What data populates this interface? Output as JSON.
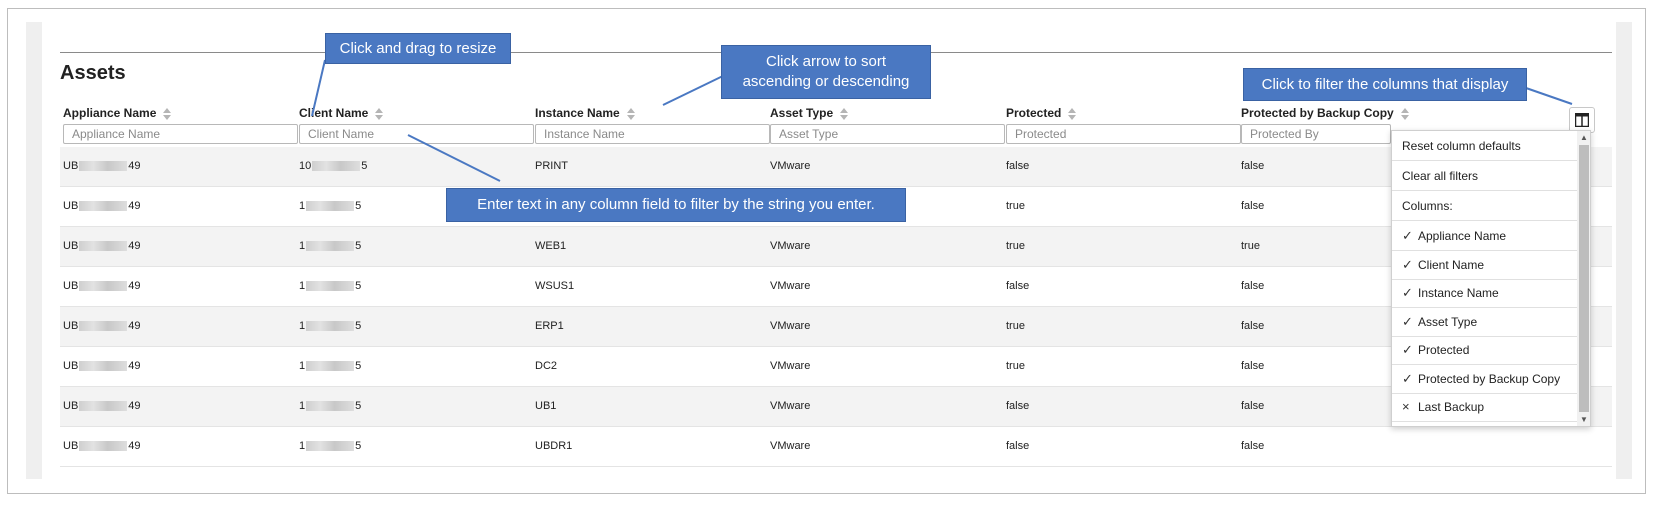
{
  "page": {
    "title": "Assets"
  },
  "columns": [
    {
      "label": "Appliance Name",
      "placeholder": "Appliance Name"
    },
    {
      "label": "Client Name",
      "placeholder": "Client Name"
    },
    {
      "label": "Instance Name",
      "placeholder": "Instance Name"
    },
    {
      "label": "Asset Type",
      "placeholder": "Asset Type"
    },
    {
      "label": "Protected",
      "placeholder": "Protected"
    },
    {
      "label": "Protected by Backup Copy",
      "placeholder": "Protected By"
    }
  ],
  "rows": [
    {
      "appliance_pre": "UB",
      "appliance_post": "49",
      "client_pre": "10",
      "client_post": "5",
      "instance": "PRINT",
      "type": "VMware",
      "protected": "false",
      "backup": "false"
    },
    {
      "appliance_pre": "UB",
      "appliance_post": "49",
      "client_pre": "1",
      "client_post": "5",
      "instance": "",
      "type": "",
      "protected": "true",
      "backup": "false"
    },
    {
      "appliance_pre": "UB",
      "appliance_post": "49",
      "client_pre": "1",
      "client_post": "5",
      "instance": "WEB1",
      "type": "VMware",
      "protected": "true",
      "backup": "true"
    },
    {
      "appliance_pre": "UB",
      "appliance_post": "49",
      "client_pre": "1",
      "client_post": "5",
      "instance": "WSUS1",
      "type": "VMware",
      "protected": "false",
      "backup": "false"
    },
    {
      "appliance_pre": "UB",
      "appliance_post": "49",
      "client_pre": "1",
      "client_post": "5",
      "instance": "ERP1",
      "type": "VMware",
      "protected": "true",
      "backup": "false"
    },
    {
      "appliance_pre": "UB",
      "appliance_post": "49",
      "client_pre": "1",
      "client_post": "5",
      "instance": "DC2",
      "type": "VMware",
      "protected": "true",
      "backup": "false"
    },
    {
      "appliance_pre": "UB",
      "appliance_post": "49",
      "client_pre": "1",
      "client_post": "5",
      "instance": "UB1",
      "type": "VMware",
      "protected": "false",
      "backup": "false"
    },
    {
      "appliance_pre": "UB",
      "appliance_post": "49",
      "client_pre": "1",
      "client_post": "5",
      "instance": "UBDR1",
      "type": "VMware",
      "protected": "false",
      "backup": "false"
    }
  ],
  "callouts": {
    "resize": "Click and drag to resize",
    "sort_line1": "Click arrow to sort",
    "sort_line2": "ascending or descending",
    "filter_columns": "Click to filter the columns that display",
    "filter_text": "Enter text in any column field to filter by the string you enter."
  },
  "column_menu": {
    "reset": "Reset column defaults",
    "clear": "Clear all filters",
    "columns_heading": "Columns:",
    "check_mark": "✓",
    "cross_mark": "×",
    "items": [
      {
        "label": "Appliance Name",
        "visible": true
      },
      {
        "label": "Client Name",
        "visible": true
      },
      {
        "label": "Instance Name",
        "visible": true
      },
      {
        "label": "Asset Type",
        "visible": true
      },
      {
        "label": "Protected",
        "visible": true
      },
      {
        "label": "Protected by Backup Copy",
        "visible": true
      },
      {
        "label": "Last Backup",
        "visible": false
      }
    ]
  },
  "colors": {
    "callout": "#4a78c2",
    "row_alt": "#f3f3f3"
  }
}
